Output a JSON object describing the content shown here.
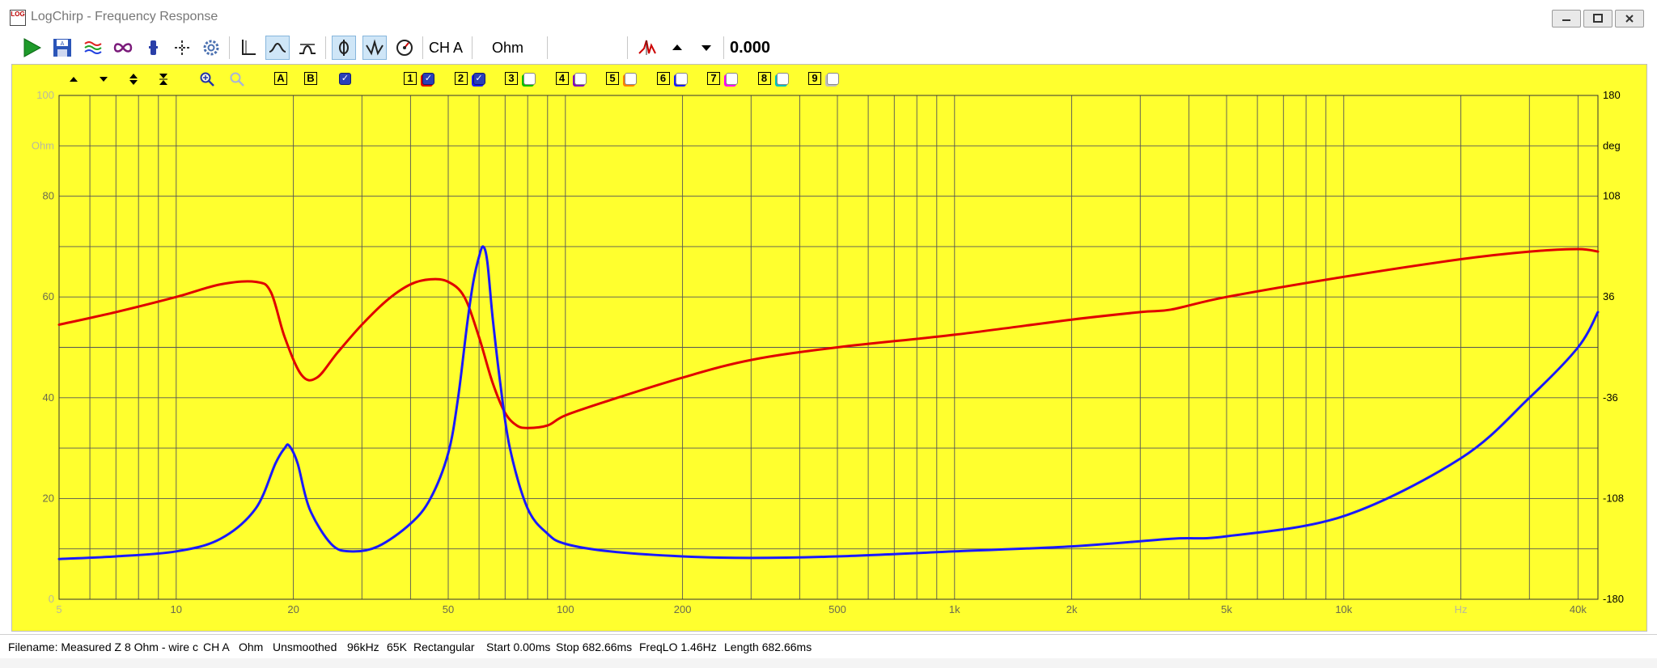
{
  "window": {
    "title": "LogChirp - Frequency Response",
    "app_icon_text": "LOG"
  },
  "toolbar": {
    "channel_label": "CH A",
    "unit_label": "Ohm",
    "readout_value": "0.000",
    "icons": [
      "play-icon",
      "save-icon",
      "spectrum-icon",
      "infinity-icon",
      "marker-icon",
      "crosshair-icon",
      "settings-icon",
      "axis-icon",
      "smooth-curve-icon",
      "phase-curve-icon",
      "phase-toggle-icon",
      "impedance-icon",
      "dial-icon",
      "peak-icon",
      "arrow-up-icon",
      "arrow-down-icon"
    ]
  },
  "plot_toolbar": {
    "icons": [
      "arrow-up-icon",
      "arrow-down-icon",
      "expand-vertical-icon",
      "compress-vertical-icon",
      "zoom-in-icon",
      "zoom-out-icon"
    ],
    "a_label": "A",
    "b_label": "B",
    "traces": [
      {
        "num": "1",
        "on": true,
        "color": "#e00000"
      },
      {
        "num": "2",
        "on": true,
        "color": "#1a1aff"
      },
      {
        "num": "3",
        "on": false,
        "color": "#00c000"
      },
      {
        "num": "4",
        "on": false,
        "color": "#8000c0"
      },
      {
        "num": "5",
        "on": false,
        "color": "#ff8000"
      },
      {
        "num": "6",
        "on": false,
        "color": "#1a1aff"
      },
      {
        "num": "7",
        "on": false,
        "color": "#ff00ff"
      },
      {
        "num": "8",
        "on": false,
        "color": "#00c0c0"
      },
      {
        "num": "9",
        "on": false,
        "color": "#c0c0c0"
      }
    ]
  },
  "chart_data": {
    "type": "line",
    "x_scale": "log",
    "xlim": [
      5,
      45000
    ],
    "ylim_left": [
      0,
      100
    ],
    "ylim_right": [
      -180,
      180
    ],
    "left_ticks": [
      "100",
      "Ohm",
      "80",
      "60",
      "40",
      "20",
      "0"
    ],
    "left_tick_values": [
      100,
      90,
      80,
      60,
      40,
      20,
      0
    ],
    "right_ticks": [
      "180",
      "deg",
      "108",
      "36",
      "-36",
      "-108",
      "-180"
    ],
    "right_tick_values": [
      180,
      144,
      108,
      36,
      -36,
      -108,
      -180
    ],
    "x_ticks": [
      "5",
      "10",
      "20",
      "50",
      "100",
      "200",
      "500",
      "1k",
      "2k",
      "5k",
      "10k",
      "Hz",
      "40k"
    ],
    "x_tick_values": [
      5,
      10,
      20,
      50,
      100,
      200,
      500,
      1000,
      2000,
      5000,
      10000,
      20000,
      40000
    ],
    "grid": true,
    "background": "#ffff2e",
    "series": [
      {
        "color": "#e00000",
        "x": [
          5,
          7,
          10,
          13,
          16,
          17.5,
          19,
          21,
          23,
          26,
          30,
          35,
          40,
          45,
          50,
          55,
          60,
          65,
          70,
          75,
          80,
          90,
          100,
          130,
          200,
          300,
          500,
          1000,
          2000,
          3000,
          3600,
          5000,
          10000,
          20000,
          30000,
          40000,
          45000
        ],
        "y": [
          54.5,
          57,
          60,
          62.5,
          63,
          61,
          52,
          44.5,
          44,
          49,
          54.5,
          59.5,
          62.5,
          63.5,
          63,
          60,
          52,
          43,
          37,
          34.5,
          34,
          34.5,
          36.5,
          39.5,
          44,
          47.5,
          50,
          52.5,
          55.5,
          57,
          57.5,
          60,
          64,
          67.5,
          69,
          69.5,
          69
        ]
      },
      {
        "color": "#1a1aff",
        "x": [
          5,
          7,
          10,
          13,
          16,
          18,
          19,
          19.5,
          20.5,
          22,
          25,
          28,
          33,
          40,
          45,
          50,
          53,
          56,
          58,
          60,
          61.5,
          63,
          65,
          68,
          72,
          80,
          90,
          100,
          130,
          200,
          300,
          500,
          1000,
          2000,
          3600,
          5000,
          10000,
          20000,
          30000,
          40000,
          45000
        ],
        "y": [
          8,
          8.5,
          9.5,
          12,
          18,
          27,
          30,
          30.5,
          27,
          18,
          11,
          9.5,
          10.5,
          15,
          20,
          29,
          40,
          55,
          63,
          68,
          70,
          67,
          56,
          43,
          30,
          18,
          13,
          11,
          9.5,
          8.5,
          8.2,
          8.5,
          9.5,
          10.5,
          12,
          12.5,
          16.5,
          28,
          40,
          50,
          57
        ]
      }
    ]
  },
  "status": {
    "items": [
      "Filename: Measured Z 8 Ohm - wire c",
      "CH A",
      "Ohm",
      "Unsmoothed",
      "96kHz",
      "65K",
      "Rectangular",
      "Start 0.00ms",
      "Stop 682.66ms",
      "FreqLO 1.46Hz",
      "Length 682.66ms"
    ]
  }
}
